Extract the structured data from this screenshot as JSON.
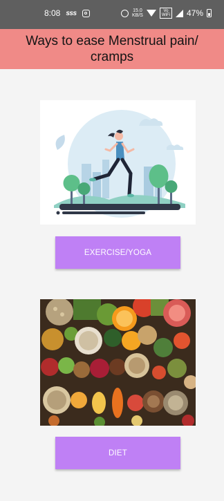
{
  "status_bar": {
    "time": "8:08",
    "carrier_icon_text": "sss",
    "net_speed_value": "15.0",
    "net_speed_unit": "KB/S",
    "volte_top": "Vo",
    "volte_bottom": "WiFi",
    "battery_percent": "47%",
    "icons": [
      "instagram-icon",
      "alarm-icon",
      "wifi-icon",
      "volte-icon",
      "signal-icon",
      "battery-icon"
    ]
  },
  "header": {
    "title": "Ways to ease Menstrual pain/ cramps",
    "background": "#f08a87"
  },
  "sections": [
    {
      "image": "woman-running-illustration",
      "button_label": "EXERCISE/YOGA"
    },
    {
      "image": "healthy-food-assortment-photo",
      "button_label": "DIET"
    }
  ],
  "colors": {
    "status_bar": "#5f5f5f",
    "page_background": "#f4f4f4",
    "button": "#bf80f5",
    "button_text": "#ffffff"
  }
}
